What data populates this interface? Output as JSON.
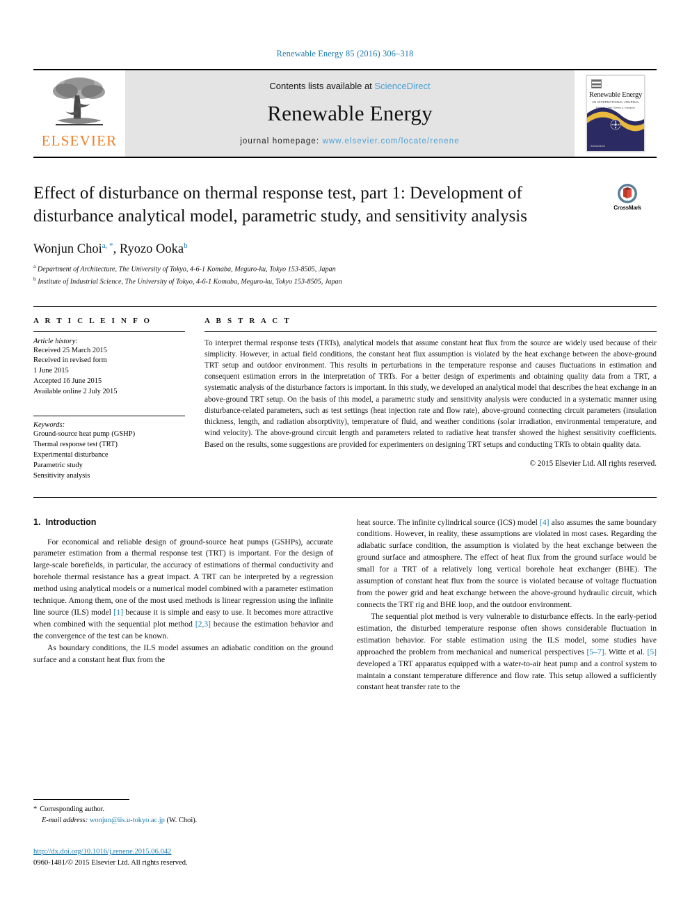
{
  "running_head": "Renewable Energy 85 (2016) 306–318",
  "masthead": {
    "publisher": "ELSEVIER",
    "contents_prefix": "Contents lists available at ",
    "contents_link": "ScienceDirect",
    "journal_name": "Renewable Energy",
    "homepage_prefix": "journal homepage: ",
    "homepage_url": "www.elsevier.com/locate/renene",
    "cover": {
      "title": "Renewable Energy",
      "subtitle": "AN INTERNATIONAL JOURNAL",
      "subtitle2": "Editor-in-Chief: Soteris A. Kalogirou",
      "footer": "ScienceDirect"
    }
  },
  "article": {
    "title": "Effect of disturbance on thermal response test, part 1: Development of disturbance analytical model, parametric study, and sensitivity analysis",
    "crossmark_label": "CrossMark",
    "authors": "Wonjun Choi, Ryozo Ooka",
    "author_list": [
      {
        "name": "Wonjun Choi",
        "marks": "a, *"
      },
      {
        "name": "Ryozo Ooka",
        "marks": "b"
      }
    ],
    "affiliations": [
      {
        "mark": "a",
        "text": "Department of Architecture, The University of Tokyo, 4-6-1 Komaba, Meguro-ku, Tokyo 153-8505, Japan"
      },
      {
        "mark": "b",
        "text": "Institute of Industrial Science, The University of Tokyo, 4-6-1 Komaba, Meguro-ku, Tokyo 153-8505, Japan"
      }
    ]
  },
  "info": {
    "heading": "A R T I C L E  I N F O",
    "history_label": "Article history:",
    "history": [
      "Received 25 March 2015",
      "Received in revised form",
      "1 June 2015",
      "Accepted 16 June 2015",
      "Available online 2 July 2015"
    ],
    "keywords_label": "Keywords:",
    "keywords": [
      "Ground-source heat pump (GSHP)",
      "Thermal response test (TRT)",
      "Experimental disturbance",
      "Parametric study",
      "Sensitivity analysis"
    ]
  },
  "abstract": {
    "heading": "A B S T R A C T",
    "text": "To interpret thermal response tests (TRTs), analytical models that assume constant heat flux from the source are widely used because of their simplicity. However, in actual field conditions, the constant heat flux assumption is violated by the heat exchange between the above-ground TRT setup and outdoor environment. This results in perturbations in the temperature response and causes fluctuations in estimation and consequent estimation errors in the interpretation of TRTs. For a better design of experiments and obtaining quality data from a TRT, a systematic analysis of the disturbance factors is important. In this study, we developed an analytical model that describes the heat exchange in an above-ground TRT setup. On the basis of this model, a parametric study and sensitivity analysis were conducted in a systematic manner using disturbance-related parameters, such as test settings (heat injection rate and flow rate), above-ground connecting circuit parameters (insulation thickness, length, and radiation absorptivity), temperature of fluid, and weather conditions (solar irradiation, environmental temperature, and wind velocity). The above-ground circuit length and parameters related to radiative heat transfer showed the highest sensitivity coefficients. Based on the results, some suggestions are provided for experimenters on designing TRT setups and conducting TRTs to obtain quality data.",
    "copyright": "© 2015 Elsevier Ltd. All rights reserved."
  },
  "introduction": {
    "number": "1.",
    "title": "Introduction",
    "left_paragraphs": [
      "For economical and reliable design of ground-source heat pumps (GSHPs), accurate parameter estimation from a thermal response test (TRT) is important. For the design of large-scale borefields, in particular, the accuracy of estimations of thermal conductivity and borehole thermal resistance has a great impact. A TRT can be interpreted by a regression method using analytical models or a numerical model combined with a parameter estimation technique. Among them, one of the most used methods is linear regression using the infinite line source (ILS) model [1] because it is simple and easy to use. It becomes more attractive when combined with the sequential plot method [2,3] because the estimation behavior and the convergence of the test can be known.",
      "As boundary conditions, the ILS model assumes an adiabatic condition on the ground surface and a constant heat flux from the"
    ],
    "right_paragraphs": [
      "heat source. The infinite cylindrical source (ICS) model [4] also assumes the same boundary conditions. However, in reality, these assumptions are violated in most cases. Regarding the adiabatic surface condition, the assumption is violated by the heat exchange between the ground surface and atmosphere. The effect of heat flux from the ground surface would be small for a TRT of a relatively long vertical borehole heat exchanger (BHE). The assumption of constant heat flux from the source is violated because of voltage fluctuation from the power grid and heat exchange between the above-ground hydraulic circuit, which connects the TRT rig and BHE loop, and the outdoor environment.",
      "The sequential plot method is very vulnerable to disturbance effects. In the early-period estimation, the disturbed temperature response often shows considerable fluctuation in estimation behavior. For stable estimation using the ILS model, some studies have approached the problem from mechanical and numerical perspectives [5–7]. Witte et al. [5] developed a TRT apparatus equipped with a water-to-air heat pump and a control system to maintain a constant temperature difference and flow rate. This setup allowed a sufficiently constant heat transfer rate to the"
    ],
    "citations": [
      "[1]",
      "[2,3]",
      "[4]",
      "[5–7]",
      "[5]"
    ]
  },
  "footer": {
    "corresponding_mark": "*",
    "corresponding_label": "Corresponding author.",
    "email_label": "E-mail address:",
    "email": "wonjun@iis.u-tokyo.ac.jp",
    "email_owner": "(W. Choi).",
    "doi": "http://dx.doi.org/10.1016/j.renene.2015.06.042",
    "issn_line": "0960-1481/© 2015 Elsevier Ltd. All rights reserved."
  },
  "colors": {
    "link": "#1a7aaf",
    "elsevier_orange": "#F07E26",
    "banner_gray": "#e4e4e4",
    "sciencedirect_blue": "#4a9fd4"
  }
}
